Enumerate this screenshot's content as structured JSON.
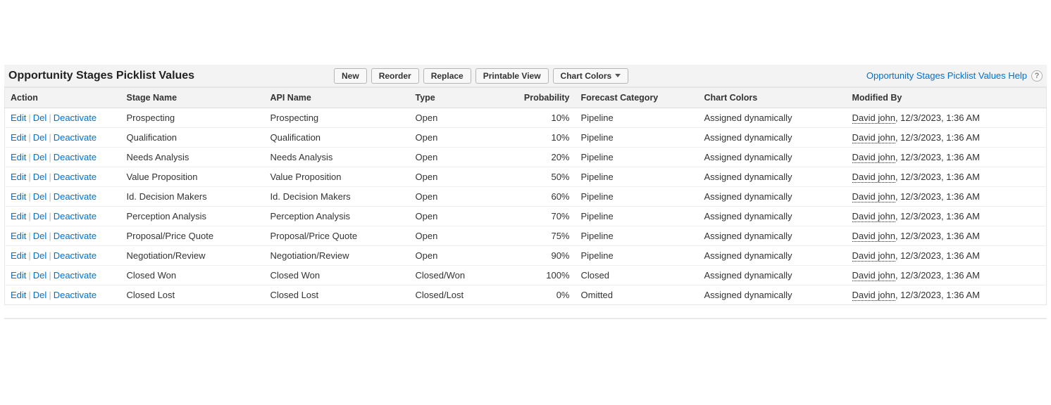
{
  "header": {
    "title": "Opportunity Stages Picklist Values",
    "buttons": {
      "new": "New",
      "reorder": "Reorder",
      "replace": "Replace",
      "printable_view": "Printable View",
      "chart_colors": "Chart Colors"
    },
    "help_link": "Opportunity Stages Picklist Values Help",
    "help_icon_char": "?"
  },
  "table": {
    "columns": {
      "action": "Action",
      "stage_name": "Stage Name",
      "api_name": "API Name",
      "type": "Type",
      "probability": "Probability",
      "forecast_category": "Forecast Category",
      "chart_colors": "Chart Colors",
      "modified_by": "Modified By"
    },
    "action_labels": {
      "edit": "Edit",
      "del": "Del",
      "deactivate": "Deactivate"
    },
    "rows": [
      {
        "stage_name": "Prospecting",
        "api_name": "Prospecting",
        "type": "Open",
        "probability": "10%",
        "forecast_category": "Pipeline",
        "chart_colors": "Assigned dynamically",
        "modified_by_name": "David john",
        "modified_by_rest": ", 12/3/2023, 1:36 AM"
      },
      {
        "stage_name": "Qualification",
        "api_name": "Qualification",
        "type": "Open",
        "probability": "10%",
        "forecast_category": "Pipeline",
        "chart_colors": "Assigned dynamically",
        "modified_by_name": "David john",
        "modified_by_rest": ", 12/3/2023, 1:36 AM"
      },
      {
        "stage_name": "Needs Analysis",
        "api_name": "Needs Analysis",
        "type": "Open",
        "probability": "20%",
        "forecast_category": "Pipeline",
        "chart_colors": "Assigned dynamically",
        "modified_by_name": "David john",
        "modified_by_rest": ", 12/3/2023, 1:36 AM"
      },
      {
        "stage_name": "Value Proposition",
        "api_name": "Value Proposition",
        "type": "Open",
        "probability": "50%",
        "forecast_category": "Pipeline",
        "chart_colors": "Assigned dynamically",
        "modified_by_name": "David john",
        "modified_by_rest": ", 12/3/2023, 1:36 AM"
      },
      {
        "stage_name": "Id. Decision Makers",
        "api_name": "Id. Decision Makers",
        "type": "Open",
        "probability": "60%",
        "forecast_category": "Pipeline",
        "chart_colors": "Assigned dynamically",
        "modified_by_name": "David john",
        "modified_by_rest": ", 12/3/2023, 1:36 AM"
      },
      {
        "stage_name": "Perception Analysis",
        "api_name": "Perception Analysis",
        "type": "Open",
        "probability": "70%",
        "forecast_category": "Pipeline",
        "chart_colors": "Assigned dynamically",
        "modified_by_name": "David john",
        "modified_by_rest": ", 12/3/2023, 1:36 AM"
      },
      {
        "stage_name": "Proposal/Price Quote",
        "api_name": "Proposal/Price Quote",
        "type": "Open",
        "probability": "75%",
        "forecast_category": "Pipeline",
        "chart_colors": "Assigned dynamically",
        "modified_by_name": "David john",
        "modified_by_rest": ", 12/3/2023, 1:36 AM"
      },
      {
        "stage_name": "Negotiation/Review",
        "api_name": "Negotiation/Review",
        "type": "Open",
        "probability": "90%",
        "forecast_category": "Pipeline",
        "chart_colors": "Assigned dynamically",
        "modified_by_name": "David john",
        "modified_by_rest": ", 12/3/2023, 1:36 AM"
      },
      {
        "stage_name": "Closed Won",
        "api_name": "Closed Won",
        "type": "Closed/Won",
        "probability": "100%",
        "forecast_category": "Closed",
        "chart_colors": "Assigned dynamically",
        "modified_by_name": "David john",
        "modified_by_rest": ", 12/3/2023, 1:36 AM"
      },
      {
        "stage_name": "Closed Lost",
        "api_name": "Closed Lost",
        "type": "Closed/Lost",
        "probability": "0%",
        "forecast_category": "Omitted",
        "chart_colors": "Assigned dynamically",
        "modified_by_name": "David john",
        "modified_by_rest": ", 12/3/2023, 1:36 AM"
      }
    ]
  }
}
